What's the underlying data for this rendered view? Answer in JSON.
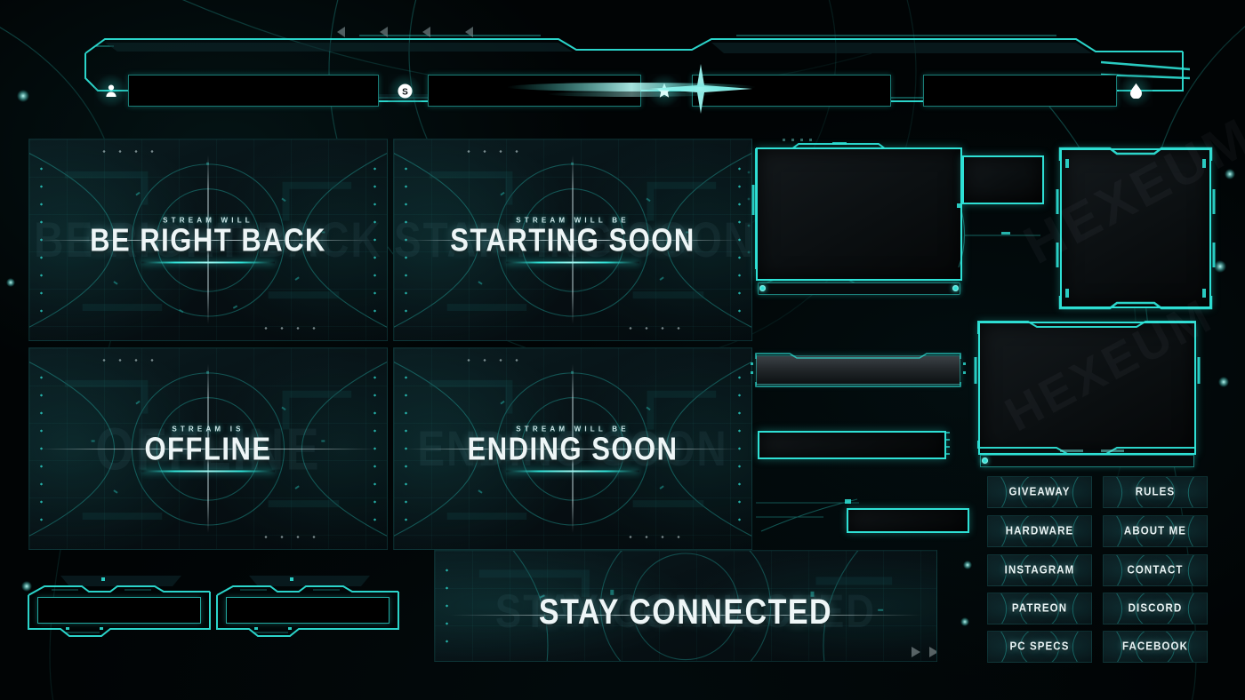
{
  "pack": {
    "title": "Sci-Fi HUD Stream Overlay Pack",
    "accent": "#2ee0d5",
    "accent_soft": "#9cf6f0",
    "background": "#010405",
    "panel_bg": "#071115",
    "text": "#eef6f7",
    "watermark": "HEXEUM"
  },
  "top_banner": {
    "name": "stream-banner",
    "fields": [
      {
        "label": "",
        "placeholder": ""
      },
      {
        "label": "",
        "placeholder": ""
      },
      {
        "label": "",
        "placeholder": ""
      },
      {
        "label": "",
        "placeholder": ""
      }
    ],
    "icons": [
      {
        "name": "user-icon",
        "glyph": "👤"
      },
      {
        "name": "dollar-icon",
        "glyph": "$"
      },
      {
        "name": "star-icon",
        "glyph": "★"
      },
      {
        "name": "diamond-icon",
        "glyph": "♦"
      }
    ]
  },
  "scenes": [
    {
      "name": "be-right-back",
      "eyebrow": "STREAM WILL",
      "title": "BE RIGHT BACK",
      "ghost": "BE RIGHT BACK",
      "size": 31
    },
    {
      "name": "starting-soon",
      "eyebrow": "STREAM WILL BE",
      "title": "STARTING SOON",
      "ghost": "STARTING SOON",
      "size": 31
    },
    {
      "name": "offline",
      "eyebrow": "STREAM IS",
      "title": "OFFLINE",
      "ghost": "OFFLINE",
      "size": 31
    },
    {
      "name": "ending-soon",
      "eyebrow": "STREAM WILL BE",
      "title": "ENDING SOON",
      "ghost": "ENDING SOON",
      "size": 31
    }
  ],
  "stay_connected": {
    "name": "stay-connected-banner",
    "title": "STAY CONNECTED",
    "ghost": "STAY CONNECTED"
  },
  "panel_buttons": [
    {
      "label": "GIVEAWAY"
    },
    {
      "label": "RULES"
    },
    {
      "label": "HARDWARE"
    },
    {
      "label": "ABOUT ME"
    },
    {
      "label": "INSTAGRAM"
    },
    {
      "label": "CONTACT"
    },
    {
      "label": "PATREON"
    },
    {
      "label": "DISCORD"
    },
    {
      "label": "PC SPECS"
    },
    {
      "label": "FACEBOOK"
    }
  ],
  "frames": {
    "webcam_large": {
      "name": "webcam-frame-large",
      "label": ""
    },
    "webcam_small": {
      "name": "webcam-frame-small",
      "label": ""
    },
    "facecam_vertical": {
      "name": "facecam-frame-vertical",
      "label": ""
    },
    "facecam_wide": {
      "name": "facecam-frame-wide",
      "label": ""
    },
    "chat_header": {
      "name": "chat-header-bar",
      "label": ""
    },
    "alert_bar": {
      "name": "alert-bar",
      "label": ""
    },
    "input_bar": {
      "name": "input-bar",
      "label": ""
    },
    "label_left": {
      "name": "label-frame-left",
      "label": ""
    },
    "label_right": {
      "name": "label-frame-right",
      "label": ""
    }
  }
}
